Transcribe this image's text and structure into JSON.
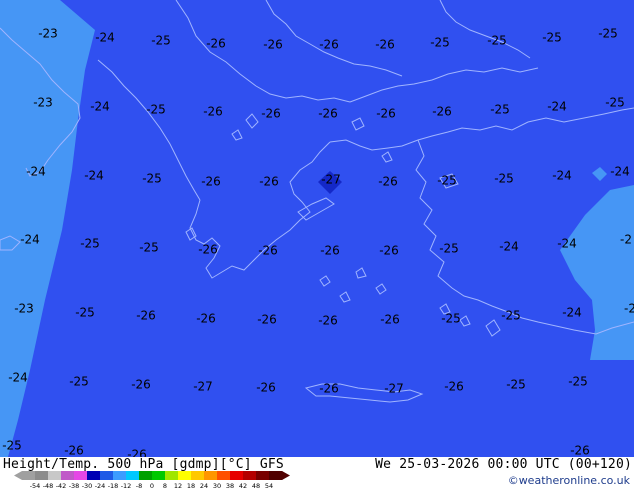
{
  "header": {
    "title_left": "Height/Temp. 500 hPa [gdmp][°C] GFS",
    "title_right": "We 25-03-2026 00:00 UTC (00+120)",
    "credit": "©weatheronline.co.uk"
  },
  "legend": {
    "ticks": [
      "-54",
      "-48",
      "-42",
      "-38",
      "-30",
      "-24",
      "-18",
      "-12",
      "-8",
      "0",
      "8",
      "12",
      "18",
      "24",
      "30",
      "38",
      "42",
      "48",
      "54"
    ],
    "colors": [
      "#a0a0a0",
      "#8c8c8c",
      "#c8c8c8",
      "#c05ac8",
      "#e646e6",
      "#0000b4",
      "#1e5ae6",
      "#3c9cff",
      "#00c8ff",
      "#00a000",
      "#00c800",
      "#a0e600",
      "#ffff00",
      "#ffc800",
      "#ff9600",
      "#ff5000",
      "#e60000",
      "#b40000",
      "#780000",
      "#500000"
    ]
  },
  "map": {
    "colors": {
      "field_main": "#3050f0",
      "field_warm": "#4696f5",
      "field_cold": "#1428c8",
      "coast": "#a0b4ff"
    },
    "temperature_labels": [
      "-23",
      "-24",
      "-25",
      "-26",
      "-26",
      "-26",
      "-26",
      "-25",
      "-25",
      "-25",
      "-25",
      "-23",
      "-24",
      "-25",
      "-26",
      "-26",
      "-26",
      "-26",
      "-26",
      "-25",
      "-24",
      "-25",
      "-24",
      "-24",
      "-25",
      "-26",
      "-26",
      "-27",
      "-26",
      "-25",
      "-25",
      "-24",
      "-24",
      "-24",
      "-25",
      "-25",
      "-26",
      "-26",
      "-26",
      "-26",
      "-25",
      "-24",
      "-24",
      "-2",
      "-23",
      "-25",
      "-26",
      "-26",
      "-26",
      "-26",
      "-26",
      "-25",
      "-25",
      "-24",
      "-2",
      "-24",
      "-25",
      "-26",
      "-27",
      "-26",
      "-26",
      "-27",
      "-26",
      "-25",
      "-25",
      "-25",
      "-26",
      "-26",
      "-26",
      "-26"
    ]
  }
}
